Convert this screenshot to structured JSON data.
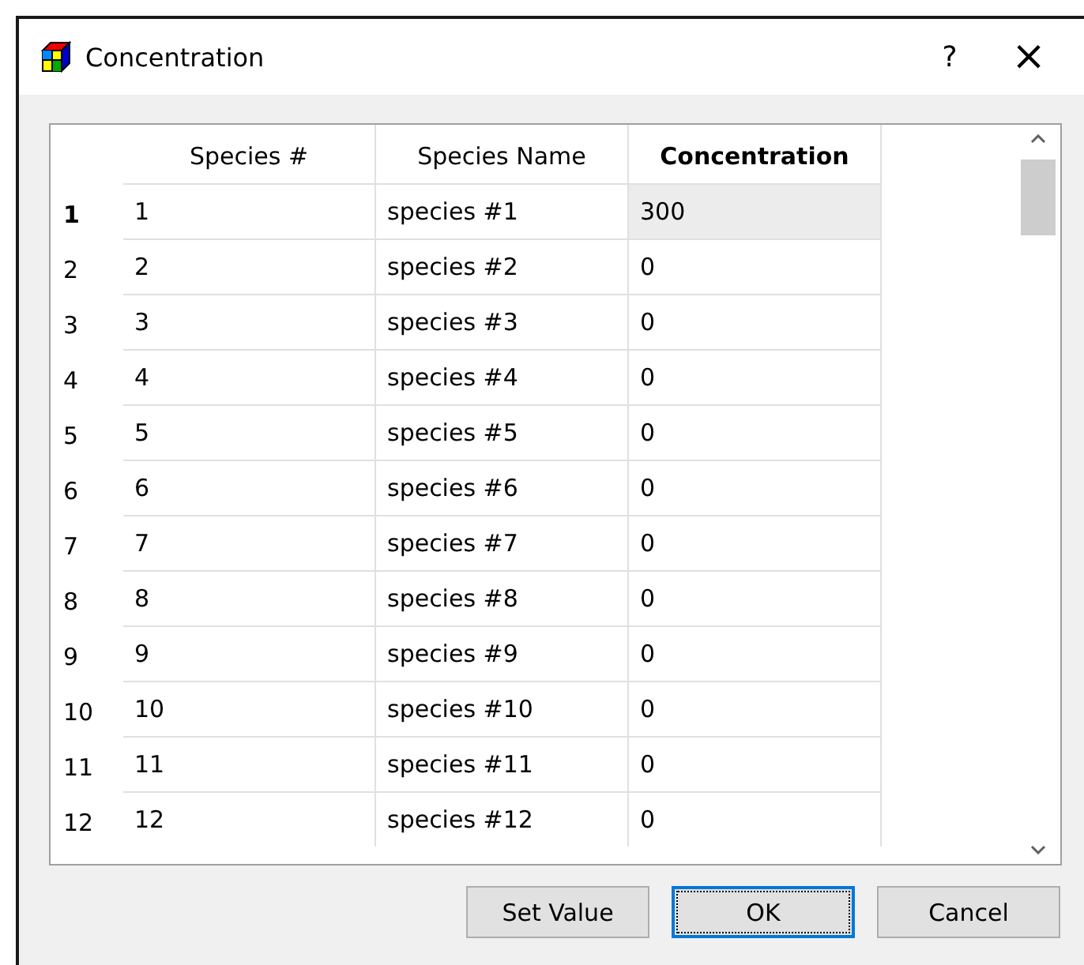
{
  "window": {
    "title": "Concentration",
    "help": "?",
    "close": "×"
  },
  "table": {
    "columns": [
      "Species #",
      "Species Name",
      "Concentration"
    ],
    "rows": [
      {
        "header": "1",
        "cells": [
          "1",
          "species #1",
          "300"
        ],
        "selected": true
      },
      {
        "header": "2",
        "cells": [
          "2",
          "species #2",
          "0"
        ],
        "selected": false
      },
      {
        "header": "3",
        "cells": [
          "3",
          "species #3",
          "0"
        ],
        "selected": false
      },
      {
        "header": "4",
        "cells": [
          "4",
          "species #4",
          "0"
        ],
        "selected": false
      },
      {
        "header": "5",
        "cells": [
          "5",
          "species #5",
          "0"
        ],
        "selected": false
      },
      {
        "header": "6",
        "cells": [
          "6",
          "species #6",
          "0"
        ],
        "selected": false
      },
      {
        "header": "7",
        "cells": [
          "7",
          "species #7",
          "0"
        ],
        "selected": false
      },
      {
        "header": "8",
        "cells": [
          "8",
          "species #8",
          "0"
        ],
        "selected": false
      },
      {
        "header": "9",
        "cells": [
          "9",
          "species #9",
          "0"
        ],
        "selected": false
      },
      {
        "header": "10",
        "cells": [
          "10",
          "species #10",
          "0"
        ],
        "selected": false
      },
      {
        "header": "11",
        "cells": [
          "11",
          "species #11",
          "0"
        ],
        "selected": false
      },
      {
        "header": "12",
        "cells": [
          "12",
          "species #12",
          "0"
        ],
        "selected": false
      }
    ]
  },
  "buttons": [
    {
      "label": "Set Value",
      "default": false
    },
    {
      "label": "OK",
      "default": true
    },
    {
      "label": "Cancel",
      "default": false
    }
  ]
}
